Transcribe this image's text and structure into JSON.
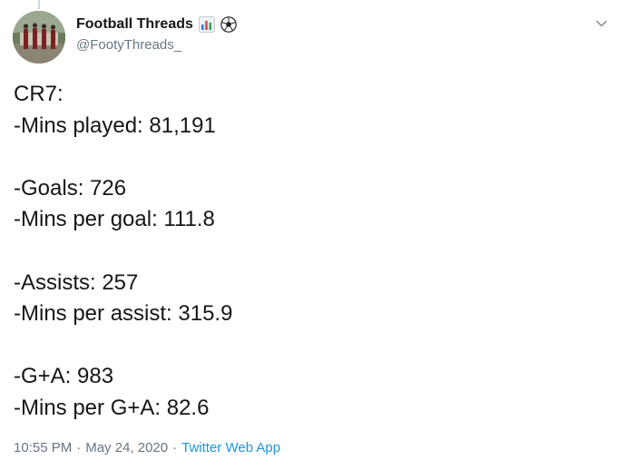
{
  "author": {
    "display_name": "Football Threads",
    "handle": "@FootyThreads_",
    "name_emoji_icons": [
      "bar-chart-icon",
      "soccer-ball-icon"
    ]
  },
  "tweet": {
    "lines": [
      "CR7:",
      "-Mins played: 81,191",
      "",
      "-Goals: 726",
      "-Mins per goal: 111.8",
      "",
      "-Assists: 257",
      "-Mins per assist: 315.9",
      "",
      "-G+A: 983",
      "-Mins per G+A: 82.6"
    ]
  },
  "meta": {
    "time": "10:55 PM",
    "separator": "·",
    "date": "May 24, 2020",
    "source_app": "Twitter Web App"
  },
  "colors": {
    "text": "#14171a",
    "secondary": "#657786",
    "link": "#1b95e0",
    "caret": "#8899a6"
  }
}
